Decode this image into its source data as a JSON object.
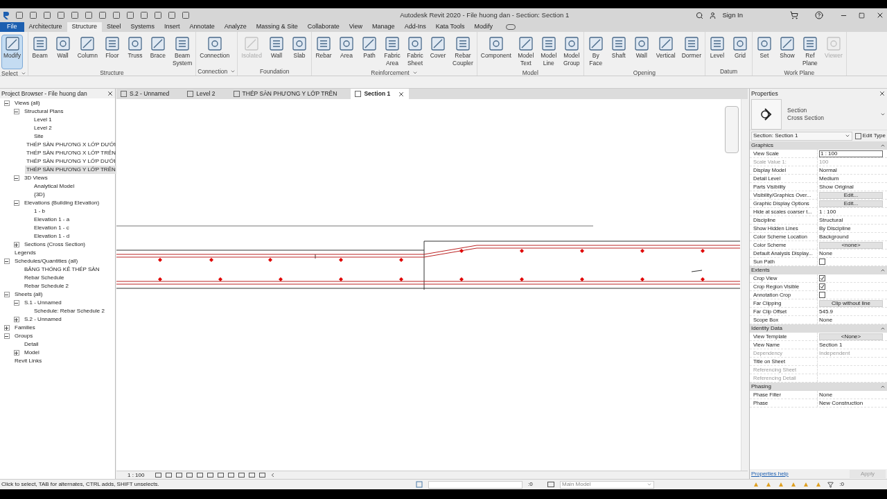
{
  "window": {
    "title": "Autodesk Revit 2020 - File huong dan - Section: Section 1",
    "sign_in": "Sign In"
  },
  "ribbon_tabs": [
    {
      "label": "File",
      "selected": false,
      "kind": "file"
    },
    {
      "label": "Architecture",
      "selected": false
    },
    {
      "label": "Structure",
      "selected": true
    },
    {
      "label": "Steel",
      "selected": false
    },
    {
      "label": "Systems",
      "selected": false
    },
    {
      "label": "Insert",
      "selected": false
    },
    {
      "label": "Annotate",
      "selected": false
    },
    {
      "label": "Analyze",
      "selected": false
    },
    {
      "label": "Massing & Site",
      "selected": false
    },
    {
      "label": "Collaborate",
      "selected": false
    },
    {
      "label": "View",
      "selected": false
    },
    {
      "label": "Manage",
      "selected": false
    },
    {
      "label": "Add-Ins",
      "selected": false
    },
    {
      "label": "Kata Tools",
      "selected": false
    },
    {
      "label": "Modify",
      "selected": false
    }
  ],
  "panels": [
    {
      "title": "Select",
      "dropdown": true,
      "tools": [
        {
          "label": "Modify",
          "selected": true,
          "disabled": false
        }
      ]
    },
    {
      "title": "Structure",
      "dropdown": false,
      "tools": [
        {
          "label": "Beam",
          "selected": false,
          "disabled": false
        },
        {
          "label": "Wall",
          "selected": false,
          "disabled": false
        },
        {
          "label": "Column",
          "selected": false,
          "disabled": false
        },
        {
          "label": "Floor",
          "selected": false,
          "disabled": false
        },
        {
          "label": "Truss",
          "selected": false,
          "disabled": false
        },
        {
          "label": "Brace",
          "selected": false,
          "disabled": false
        },
        {
          "label": "Beam System",
          "selected": false,
          "disabled": false
        }
      ]
    },
    {
      "title": "Connection",
      "dropdown": true,
      "tools": [
        {
          "label": "Connection",
          "selected": false,
          "disabled": false
        }
      ]
    },
    {
      "title": "Foundation",
      "dropdown": false,
      "tools": [
        {
          "label": "Isolated",
          "selected": false,
          "disabled": true
        },
        {
          "label": "Wall",
          "selected": false,
          "disabled": false
        },
        {
          "label": "Slab",
          "selected": false,
          "disabled": false
        }
      ]
    },
    {
      "title": "Reinforcement",
      "dropdown": true,
      "tools": [
        {
          "label": "Rebar",
          "selected": false,
          "disabled": false
        },
        {
          "label": "Area",
          "selected": false,
          "disabled": false
        },
        {
          "label": "Path",
          "selected": false,
          "disabled": false
        },
        {
          "label": "Fabric Area",
          "selected": false,
          "disabled": false
        },
        {
          "label": "Fabric Sheet",
          "selected": false,
          "disabled": false
        },
        {
          "label": "Cover",
          "selected": false,
          "disabled": false
        },
        {
          "label": "Rebar Coupler",
          "selected": false,
          "disabled": false
        }
      ]
    },
    {
      "title": "Model",
      "dropdown": false,
      "tools": [
        {
          "label": "Component",
          "selected": false,
          "disabled": false
        },
        {
          "label": "Model Text",
          "selected": false,
          "disabled": false
        },
        {
          "label": "Model Line",
          "selected": false,
          "disabled": false
        },
        {
          "label": "Model Group",
          "selected": false,
          "disabled": false
        }
      ]
    },
    {
      "title": "Opening",
      "dropdown": false,
      "tools": [
        {
          "label": "By Face",
          "selected": false,
          "disabled": false
        },
        {
          "label": "Shaft",
          "selected": false,
          "disabled": false
        },
        {
          "label": "Wall",
          "selected": false,
          "disabled": false
        },
        {
          "label": "Vertical",
          "selected": false,
          "disabled": false
        },
        {
          "label": "Dormer",
          "selected": false,
          "disabled": false
        }
      ]
    },
    {
      "title": "Datum",
      "dropdown": false,
      "tools": [
        {
          "label": "Level",
          "selected": false,
          "disabled": false
        },
        {
          "label": "Grid",
          "selected": false,
          "disabled": false
        }
      ]
    },
    {
      "title": "Work Plane",
      "dropdown": false,
      "tools": [
        {
          "label": "Set",
          "selected": false,
          "disabled": false
        },
        {
          "label": "Show",
          "selected": false,
          "disabled": false
        },
        {
          "label": "Ref Plane",
          "selected": false,
          "disabled": false
        },
        {
          "label": "Viewer",
          "selected": false,
          "disabled": true
        }
      ]
    }
  ],
  "project_browser": {
    "title": "Project Browser - File huong dan",
    "tree": [
      {
        "label": "Views (all)",
        "expanded": true,
        "selected": false,
        "children": [
          {
            "label": "Structural Plans",
            "expanded": true,
            "selected": false,
            "children": [
              {
                "label": "Level 1",
                "selected": false
              },
              {
                "label": "Level 2",
                "selected": false
              },
              {
                "label": "Site",
                "selected": false
              },
              {
                "label": "THÉP SÀN PHƯƠNG X LỚP DƯỚI",
                "selected": false
              },
              {
                "label": "THÉP SÀN PHƯƠNG X LỚP TRÊN",
                "selected": false
              },
              {
                "label": "THÉP SÀN PHƯƠNG Y LỚP DƯỚI",
                "selected": false
              },
              {
                "label": "THÉP SÀN PHƯƠNG Y LỚP TRÊN",
                "selected": true
              }
            ]
          },
          {
            "label": "3D Views",
            "expanded": true,
            "selected": false,
            "children": [
              {
                "label": "Analytical Model",
                "selected": false
              },
              {
                "label": "{3D}",
                "selected": false
              }
            ]
          },
          {
            "label": "Elevations (Building Elevation)",
            "expanded": true,
            "selected": false,
            "children": [
              {
                "label": "1 - b",
                "selected": false
              },
              {
                "label": "Elevation 1 - a",
                "selected": false
              },
              {
                "label": "Elevation 1 - c",
                "selected": false
              },
              {
                "label": "Elevation 1 - d",
                "selected": false
              }
            ]
          },
          {
            "label": "Sections (Cross Section)",
            "expanded": false,
            "selected": false
          }
        ]
      },
      {
        "label": "Legends",
        "selected": false
      },
      {
        "label": "Schedules/Quantities (all)",
        "expanded": true,
        "selected": false,
        "children": [
          {
            "label": "BẢNG THỐNG KÊ THÉP SÀN",
            "selected": false
          },
          {
            "label": "Rebar Schedule",
            "selected": false
          },
          {
            "label": "Rebar Schedule 2",
            "selected": false
          }
        ]
      },
      {
        "label": "Sheets (all)",
        "expanded": true,
        "selected": false,
        "children": [
          {
            "label": "S.1 - Unnamed",
            "expanded": true,
            "selected": false,
            "children": [
              {
                "label": "Schedule: Rebar Schedule 2",
                "selected": false
              }
            ]
          },
          {
            "label": "S.2 - Unnamed",
            "expanded": false,
            "selected": false
          }
        ]
      },
      {
        "label": "Families",
        "expanded": false,
        "selected": false
      },
      {
        "label": "Groups",
        "expanded": true,
        "selected": false,
        "children": [
          {
            "label": "Detail",
            "selected": false
          },
          {
            "label": "Model",
            "expanded": false,
            "selected": false
          }
        ]
      },
      {
        "label": "Revit Links",
        "selected": false
      }
    ]
  },
  "view_tabs": [
    {
      "label": "S.2 - Unnamed",
      "selected": false
    },
    {
      "label": "Level 2",
      "selected": false
    },
    {
      "label": "THÉP SÀN PHƯƠNG Y LỚP TRÊN",
      "selected": false
    },
    {
      "label": "Section 1",
      "selected": true
    }
  ],
  "view_bar": {
    "scale": "1 : 100"
  },
  "properties": {
    "title": "Properties",
    "type_family": "Section",
    "type_name": "Cross Section",
    "selector": "Section: Section 1",
    "edit_type": "Edit Type",
    "groups": [
      {
        "name": "Graphics",
        "rows": [
          {
            "name": "View Scale",
            "value": "1 : 100",
            "kind": "input",
            "disabled": false
          },
          {
            "name": "Scale Value    1:",
            "value": "100",
            "kind": "text",
            "disabled": true
          },
          {
            "name": "Display Model",
            "value": "Normal",
            "kind": "text",
            "disabled": false
          },
          {
            "name": "Detail Level",
            "value": "Medium",
            "kind": "text",
            "disabled": false
          },
          {
            "name": "Parts Visibility",
            "value": "Show Original",
            "kind": "text",
            "disabled": false
          },
          {
            "name": "Visibility/Graphics Over...",
            "value": "Edit...",
            "kind": "button",
            "disabled": false
          },
          {
            "name": "Graphic Display Options",
            "value": "Edit...",
            "kind": "button",
            "disabled": false
          },
          {
            "name": "Hide at scales coarser t...",
            "value": "1 : 100",
            "kind": "text",
            "disabled": false
          },
          {
            "name": "Discipline",
            "value": "Structural",
            "kind": "text",
            "disabled": false
          },
          {
            "name": "Show Hidden Lines",
            "value": "By Discipline",
            "kind": "text",
            "disabled": false
          },
          {
            "name": "Color Scheme Location",
            "value": "Background",
            "kind": "text",
            "disabled": false
          },
          {
            "name": "Color Scheme",
            "value": "<none>",
            "kind": "button",
            "disabled": false
          },
          {
            "name": "Default Analysis Display...",
            "value": "None",
            "kind": "text",
            "disabled": false
          },
          {
            "name": "Sun Path",
            "kind": "checkbox",
            "checked": false,
            "disabled": false
          }
        ]
      },
      {
        "name": "Extents",
        "rows": [
          {
            "name": "Crop View",
            "kind": "checkbox",
            "checked": true,
            "disabled": false
          },
          {
            "name": "Crop Region Visible",
            "kind": "checkbox",
            "checked": true,
            "disabled": false
          },
          {
            "name": "Annotation Crop",
            "kind": "checkbox",
            "checked": false,
            "disabled": false
          },
          {
            "name": "Far Clipping",
            "value": "Clip without line",
            "kind": "button",
            "disabled": false
          },
          {
            "name": "Far Clip Offset",
            "value": "545.9",
            "kind": "text",
            "disabled": false
          },
          {
            "name": "Scope Box",
            "value": "None",
            "kind": "text",
            "disabled": false
          }
        ]
      },
      {
        "name": "Identity Data",
        "rows": [
          {
            "name": "View Template",
            "value": "<None>",
            "kind": "button",
            "disabled": false
          },
          {
            "name": "View Name",
            "value": "Section 1",
            "kind": "text",
            "disabled": false
          },
          {
            "name": "Dependency",
            "value": "Independent",
            "kind": "text",
            "disabled": true
          },
          {
            "name": "Title on Sheet",
            "kind": "text",
            "disabled": false
          },
          {
            "name": "Referencing Sheet",
            "kind": "text",
            "disabled": true
          },
          {
            "name": "Referencing Detail",
            "kind": "text",
            "disabled": true
          }
        ]
      },
      {
        "name": "Phasing",
        "rows": [
          {
            "name": "Phase Filter",
            "value": "None",
            "kind": "text",
            "disabled": false
          },
          {
            "name": "Phase",
            "value": "New Construction",
            "kind": "text",
            "disabled": false
          }
        ]
      }
    ],
    "help": "Properties help",
    "apply": {
      "label": "Apply",
      "disabled": true
    }
  },
  "status_bar": {
    "message": "Click to select, TAB for alternates, CTRL adds, SHIFT unselects.",
    "workset_count": ":0",
    "model": "Main Model",
    "filter_count": ":0"
  }
}
